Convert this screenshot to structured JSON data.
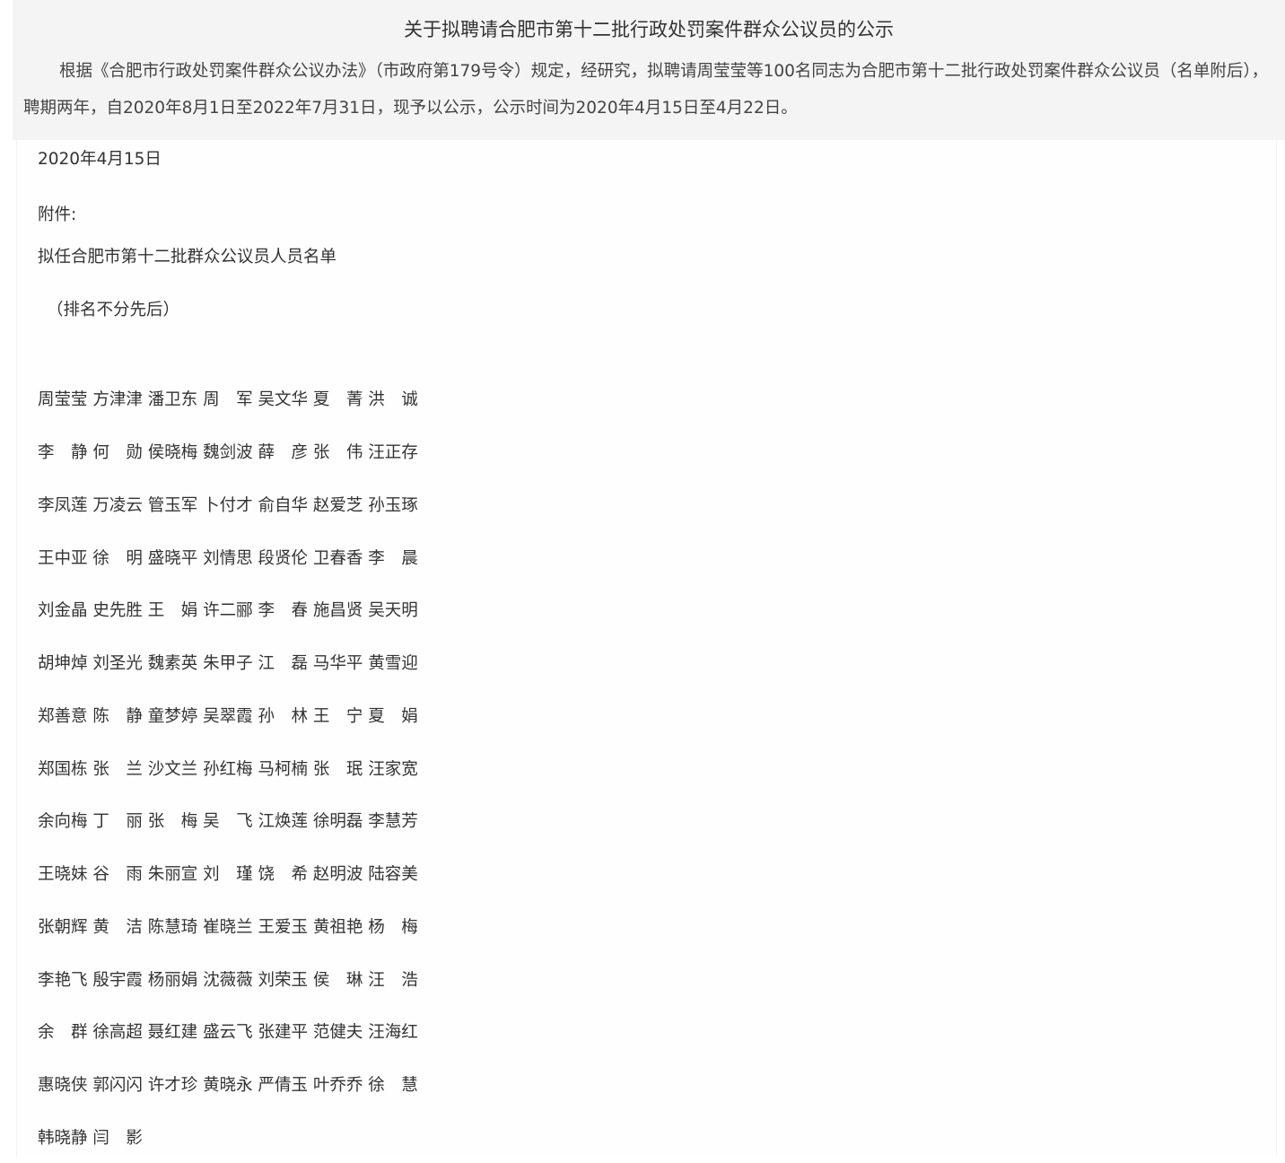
{
  "title": "关于拟聘请合肥市第十二批行政处罚案件群众公议员的公示",
  "intro": "根据《合肥市行政处罚案件群众公议办法》（市政府第179号令）规定，经研究，拟聘请周莹莹等100名同志为合肥市第十二批行政处罚案件群众公议员（名单附后），聘期两年，自2020年8月1日至2022年7月31日，现予以公示，公示时间为2020年4月15日至4月22日。",
  "date": "2020年4月15日",
  "attachment_label": "附件:",
  "list_title": "拟任合肥市第十二批群众公议员人员名单",
  "order_note": "（排名不分先后）",
  "name_rows": [
    "周莹莹 方津津 潘卫东 周　军 吴文华 夏　菁 洪　诚",
    "李　静 何　勋 侯晓梅 魏剑波 薛　彦 张　伟 汪正存",
    "李凤莲 万凌云 管玉军 卜付才 俞自华 赵爱芝 孙玉琢",
    "王中亚 徐　明 盛晓平 刘情思 段贤伦 卫春香 李　晨",
    "刘金晶 史先胜 王　娟 许二郦 李　春 施昌贤 吴天明",
    "胡坤焯 刘圣光 魏素英 朱甲子 江　磊 马华平 黄雪迎",
    "郑善意 陈　静 童梦婷 吴翠霞 孙　林 王　宁 夏　娟",
    "郑国栋 张　兰 沙文兰 孙红梅 马柯楠 张　珉 汪家宽",
    "余向梅 丁　丽 张　梅 吴　飞 江焕莲 徐明磊 李慧芳",
    "王晓妹 谷　雨 朱丽宣 刘　瑾 饶　希 赵明波 陆容美",
    "张朝辉 黄　洁 陈慧琦 崔晓兰 王爱玉 黄祖艳 杨　梅",
    "李艳飞 殷宇霞 杨丽娟 沈薇薇 刘荣玉 侯　琳 汪　浩",
    "余　群 徐高超 聂红建 盛云飞 张建平 范健夫 汪海红",
    "惠晓侠 郭闪闪 许才珍 黄晓永 严倩玉 叶乔乔 徐　慧",
    "韩晓静 闫　影"
  ]
}
